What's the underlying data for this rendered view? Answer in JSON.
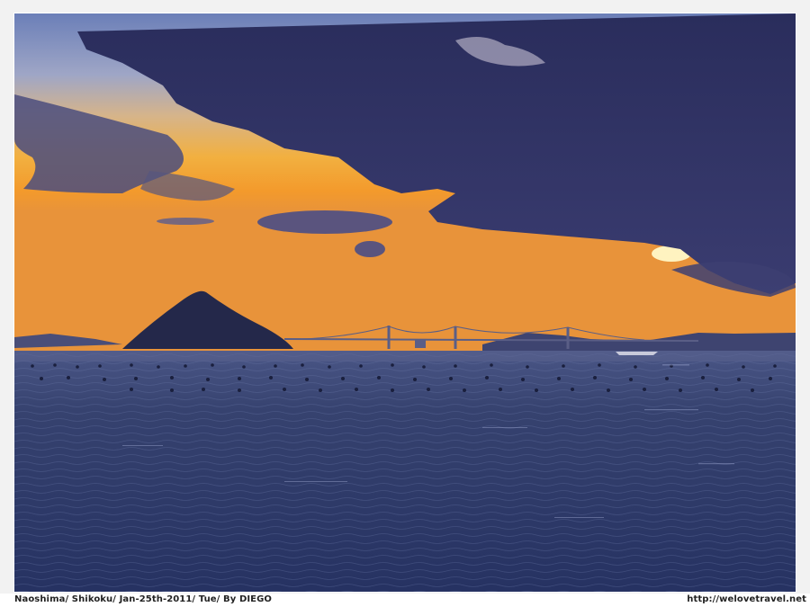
{
  "photo": {
    "caption": "Naoshima/ Shikoku/ Jan-25th-2011/ Tue/ By DIEGO",
    "website": "http://welovetravel.net"
  },
  "colors": {
    "frame": "#f2f2f2",
    "sky_dark": "#2c2f66",
    "sunset_orange": "#f0a030",
    "water": "#2d3a6e"
  }
}
